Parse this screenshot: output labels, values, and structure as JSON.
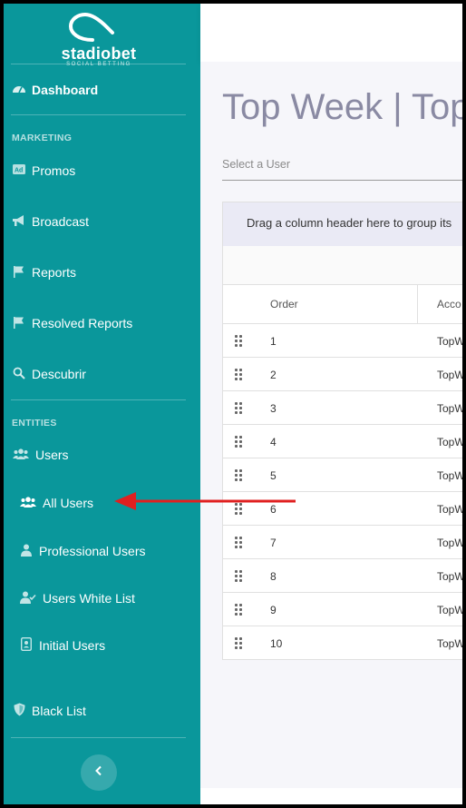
{
  "brand": {
    "name": "stadiobet",
    "tagline": "SOCIAL BETTING"
  },
  "sidebar": {
    "dashboard": "Dashboard",
    "marketing_header": "MARKETING",
    "marketing_items": [
      {
        "label": "Promos",
        "icon": "ad-icon"
      },
      {
        "label": "Broadcast",
        "icon": "bullhorn-icon"
      },
      {
        "label": "Reports",
        "icon": "flag-icon"
      },
      {
        "label": "Resolved Reports",
        "icon": "flag-icon"
      },
      {
        "label": "Descubrir",
        "icon": "search-icon"
      }
    ],
    "entities_header": "ENTITIES",
    "users": "Users",
    "users_items": [
      {
        "label": "All Users",
        "icon": "users-icon"
      },
      {
        "label": "Professional Users",
        "icon": "user-tie-icon"
      },
      {
        "label": "Users White List",
        "icon": "user-check-icon"
      },
      {
        "label": "Initial Users",
        "icon": "id-badge-icon"
      }
    ],
    "black_list": "Black List"
  },
  "main": {
    "title": "Top Week | Top",
    "select_user_placeholder": "Select a User",
    "grid": {
      "group_panel_text": "Drag a column header here to group its",
      "columns": [
        "Order",
        "Acco"
      ],
      "rows": [
        {
          "order": "1",
          "acc": "TopW"
        },
        {
          "order": "2",
          "acc": "TopW"
        },
        {
          "order": "3",
          "acc": "TopW"
        },
        {
          "order": "4",
          "acc": "TopW"
        },
        {
          "order": "5",
          "acc": "TopW"
        },
        {
          "order": "6",
          "acc": "TopW"
        },
        {
          "order": "7",
          "acc": "TopW"
        },
        {
          "order": "8",
          "acc": "TopW"
        },
        {
          "order": "9",
          "acc": "TopW"
        },
        {
          "order": "10",
          "acc": "TopW"
        }
      ]
    }
  },
  "colors": {
    "sidebar_bg": "#0a979b",
    "annotation_arrow": "#e02020",
    "title": "#8a8aa3"
  }
}
